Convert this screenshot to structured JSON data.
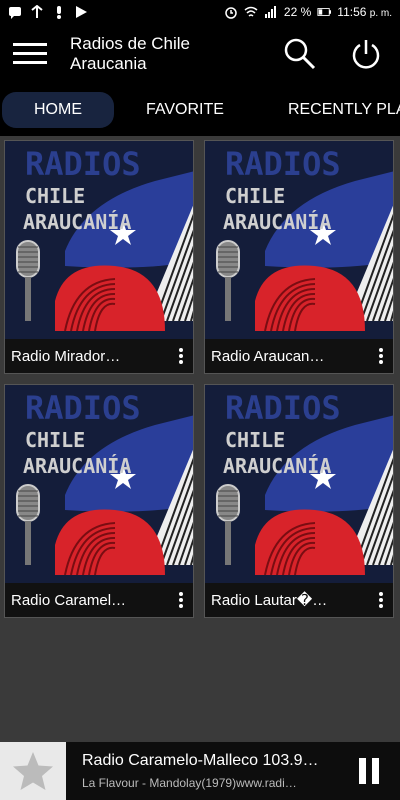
{
  "statusbar": {
    "battery": "22 %",
    "time": "11:56",
    "ampm": "p. m."
  },
  "appbar": {
    "title_line1": "Radios de Chile",
    "title_line2": "Araucania"
  },
  "tabs": [
    {
      "label": "HOME"
    },
    {
      "label": "FAVORITE"
    },
    {
      "label": "RECENTLY PLAYED"
    }
  ],
  "cards": [
    {
      "label": "Radio Mirador…"
    },
    {
      "label": "Radio Araucan…"
    },
    {
      "label": "Radio Caramel…"
    },
    {
      "label": "Radio Lautar�…"
    }
  ],
  "artwork": {
    "line1": "RADIOS",
    "line2": "CHILE",
    "line3": "ARAUCANÍA"
  },
  "player": {
    "title": "Radio Caramelo-Malleco 103.9…",
    "subtitle": "La Flavour - Mandolay(1979)www.radi…"
  },
  "colors": {
    "appbar": "#000000",
    "background": "#3a3a3a",
    "active_tab": "#18243f",
    "flag_blue": "#2a3e9a",
    "flag_red": "#d8232a"
  }
}
